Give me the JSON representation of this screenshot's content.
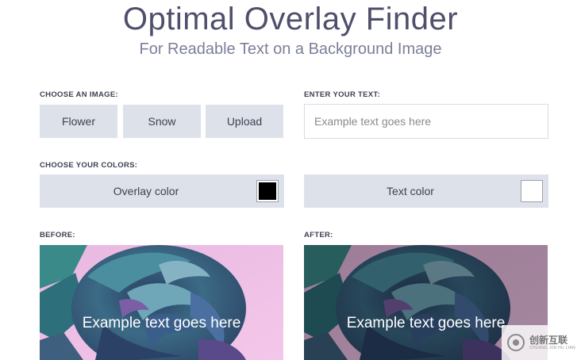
{
  "header": {
    "title": "Optimal Overlay Finder",
    "subtitle": "For Readable Text on a Background Image"
  },
  "image_section": {
    "label": "CHOOSE AN IMAGE:",
    "buttons": [
      "Flower",
      "Snow",
      "Upload"
    ]
  },
  "text_section": {
    "label": "ENTER YOUR TEXT:",
    "placeholder": "Example text goes here",
    "value": ""
  },
  "colors_section": {
    "label": "CHOOSE YOUR COLORS:",
    "overlay_label": "Overlay color",
    "overlay_color": "#000000",
    "text_label": "Text color",
    "text_color": "#ffffff"
  },
  "before": {
    "label": "BEFORE:",
    "preview_text": "Example text goes here"
  },
  "after": {
    "label": "AFTER:",
    "preview_text": "Example text goes here"
  },
  "watermark": {
    "main": "创新互联",
    "sub": "CHUANG XIN HU LIAN"
  }
}
